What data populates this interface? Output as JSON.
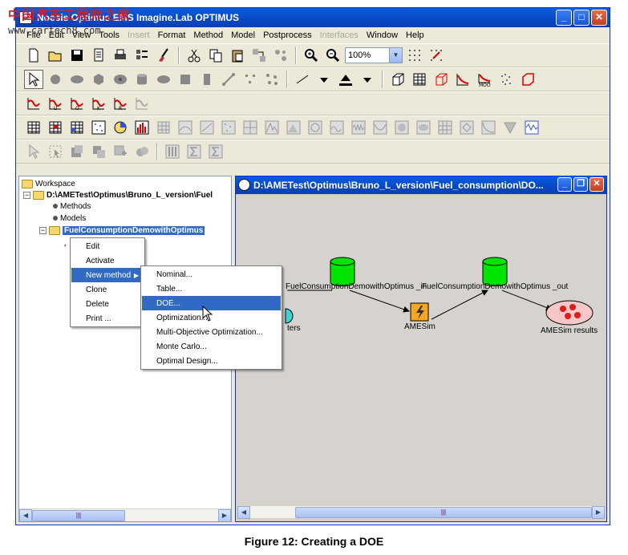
{
  "watermark": {
    "chinese": "中国汽车工程师之家",
    "url": "www.cartech8.com"
  },
  "window": {
    "title": "Noesis Optimus EMS Imagine.Lab OPTIMUS",
    "app_icon": "Ö",
    "minimize": "_",
    "maximize": "□",
    "close": "✕"
  },
  "menus": [
    {
      "label": "File",
      "enabled": true
    },
    {
      "label": "Edit",
      "enabled": true
    },
    {
      "label": "View",
      "enabled": true
    },
    {
      "label": "Tools",
      "enabled": true
    },
    {
      "label": "Insert",
      "enabled": false
    },
    {
      "label": "Format",
      "enabled": true
    },
    {
      "label": "Method",
      "enabled": true
    },
    {
      "label": "Model",
      "enabled": true
    },
    {
      "label": "Postprocess",
      "enabled": true
    },
    {
      "label": "Interfaces",
      "enabled": false
    },
    {
      "label": "Window",
      "enabled": true
    },
    {
      "label": "Help",
      "enabled": true
    }
  ],
  "toolbar": {
    "zoom_value": "100%",
    "zoom_arrow": "▼"
  },
  "tree": {
    "workspace": "Workspace",
    "project_path": "D:\\AMETest\\Optimus\\Bruno_L_version\\Fuel",
    "methods": "Methods",
    "models": "Models",
    "workflow": "FuelConsumptionDemowithOptimus",
    "expander_minus": "−",
    "red_mark": "'"
  },
  "context_menu": {
    "items": [
      "Edit",
      "Activate",
      "New method",
      "Clone",
      "Delete",
      "Print ..."
    ],
    "submenu_arrow": "▶"
  },
  "submenu": {
    "items": [
      "Nominal...",
      "Table...",
      "DOE...",
      "Optimization...",
      "Multi-Objective Optimization...",
      "Monte Carlo...",
      "Optimal Design..."
    ]
  },
  "inner_window": {
    "title": "D:\\AMETest\\Optimus\\Bruno_L_version\\Fuel_consumption\\DO...",
    "minimize": "_",
    "restore": "❐",
    "close": "✕"
  },
  "workflow": {
    "input_label": "FuelConsumptionDemowithOptimus _in",
    "output_label": "FuelConsumptionDemowithOptimus _out",
    "solver_label": "AMESim",
    "results_label": "AMESim results",
    "params_label": "ters"
  },
  "scrollbars": {
    "left": "◀",
    "right": "▶",
    "thumb_grip": "|||"
  },
  "caption": "Figure 12: Creating a DOE",
  "colors": {
    "titlebar": "#0a5ddf",
    "selection": "#316ac5",
    "database_node": "#00e400",
    "solver_node": "#f5a623",
    "results_node": "#f7c6c6",
    "results_dots": "#e01b1b",
    "params_node": "#3cd3d3",
    "graph_icons": "#d00000"
  }
}
